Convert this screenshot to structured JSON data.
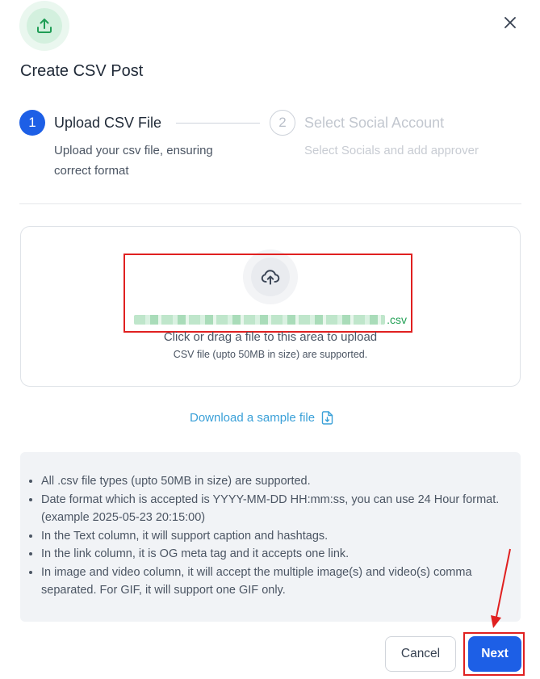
{
  "dialog": {
    "title": "Create CSV Post",
    "header_icon": "upload-icon",
    "close_icon": "close-icon"
  },
  "steps": [
    {
      "number": "1",
      "title": "Upload CSV File",
      "description": "Upload your csv file, ensuring correct format",
      "state": "active"
    },
    {
      "number": "2",
      "title": "Select Social Account",
      "description": "Select Socials and add approver",
      "state": "inactive"
    }
  ],
  "upload": {
    "icon": "cloud-upload-icon",
    "file_extension": ".csv",
    "main_text": "Click or drag a file to this area to upload",
    "sub_text": "CSV file (upto 50MB in size) are supported."
  },
  "download": {
    "label": "Download a sample file",
    "icon": "file-download-icon"
  },
  "info": {
    "items": [
      "All .csv file types (upto 50MB in size) are supported.",
      "Date format which is accepted is YYYY-MM-DD HH:mm:ss, you can use 24 Hour format. (example 2025-05-23 20:15:00)",
      "In the Text column, it will support caption and hashtags.",
      "In the link column, it is OG meta tag and it accepts one link.",
      "In image and video column, it will accept the multiple image(s) and video(s) comma separated. For GIF, it will support one GIF only."
    ]
  },
  "footer": {
    "cancel_label": "Cancel",
    "next_label": "Next"
  },
  "colors": {
    "primary": "#1d5fe6",
    "success": "#22a055",
    "link": "#3aa0d8",
    "annotation": "#e02020"
  }
}
